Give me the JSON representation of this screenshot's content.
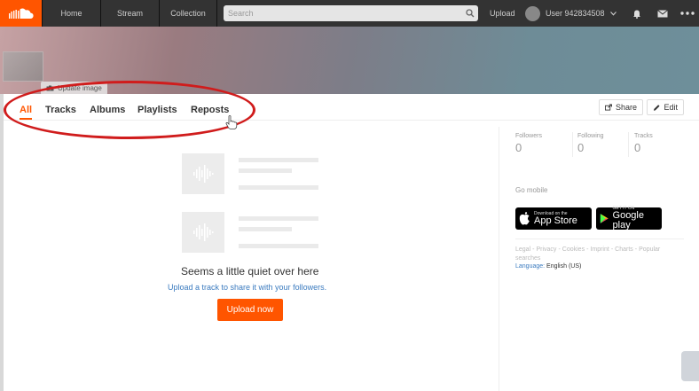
{
  "nav": {
    "home": "Home",
    "stream": "Stream",
    "collection": "Collection",
    "search_placeholder": "Search",
    "upload": "Upload",
    "user": "User 942834508"
  },
  "header": {
    "update_image": "Update image"
  },
  "tabs": [
    "All",
    "Tracks",
    "Albums",
    "Playlists",
    "Reposts"
  ],
  "actions": {
    "share": "Share",
    "edit": "Edit"
  },
  "empty_state": {
    "title": "Seems a little quiet over here",
    "subtitle": "Upload a track to share it with your followers.",
    "button": "Upload now"
  },
  "stats": [
    {
      "label": "Followers",
      "value": "0"
    },
    {
      "label": "Following",
      "value": "0"
    },
    {
      "label": "Tracks",
      "value": "0"
    }
  ],
  "mobile": {
    "heading": "Go mobile",
    "app_store_small": "Download on the",
    "app_store_big": "App Store",
    "google_small": "GET IT ON",
    "google_big": "Google play"
  },
  "footer": {
    "links": [
      "Legal",
      "Privacy",
      "Cookies",
      "Imprint",
      "Charts",
      "Popular searches"
    ],
    "language_label": "Language:",
    "language_value": "English (US)"
  },
  "colors": {
    "brand": "#ff5500",
    "link": "#3b7bbf",
    "annotation": "#d01c1c"
  }
}
